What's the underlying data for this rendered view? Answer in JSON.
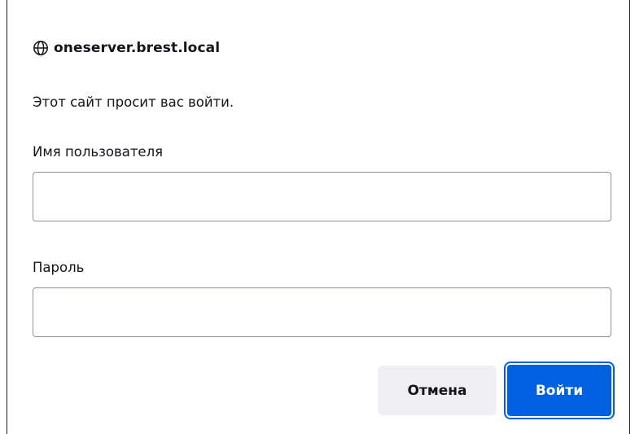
{
  "dialog": {
    "origin": "oneserver.brest.local",
    "message": "Этот сайт просит вас войти.",
    "username_label": "Имя пользователя",
    "username_value": "",
    "password_label": "Пароль",
    "password_value": "",
    "cancel_label": "Отмена",
    "login_label": "Войти"
  },
  "icons": {
    "origin_icon": "globe-icon"
  },
  "colors": {
    "primary": "#0061e0",
    "secondary_button": "#f0f0f4",
    "input_border": "#8f8f9d",
    "text": "#15141a"
  }
}
